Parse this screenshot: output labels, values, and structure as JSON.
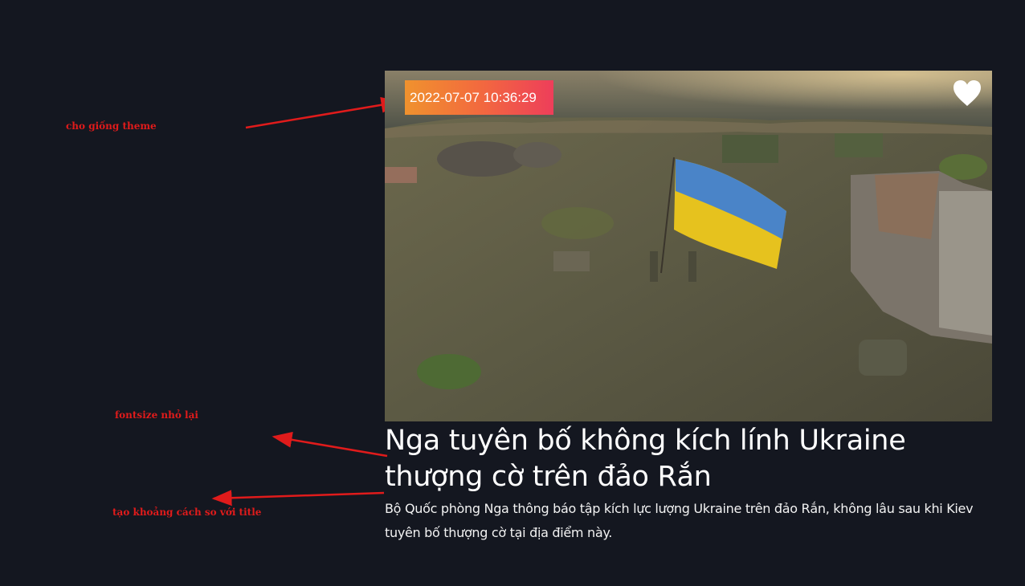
{
  "annotations": {
    "theme_note": "cho giống theme",
    "fontsize_note": "fontsize nhỏ lại",
    "spacing_note": "tạo khoảng cách so với title"
  },
  "article": {
    "datetime": "2022-07-07 10:36:29",
    "title": "Nga tuyên bố không kích lính Ukraine thượng cờ trên đảo Rắn",
    "description": "Bộ Quốc phòng Nga thông báo tập kích lực lượng Ukraine trên đảo Rắn, không lâu sau khi Kiev tuyên bố thượng cờ tại địa điểm này.",
    "favorite_icon": "heart-icon"
  },
  "colors": {
    "background": "#141720",
    "annotation": "#e01b1b",
    "badge_gradient_start": "#f0922e",
    "badge_gradient_end": "#ee3e5a",
    "text": "#ffffff"
  }
}
